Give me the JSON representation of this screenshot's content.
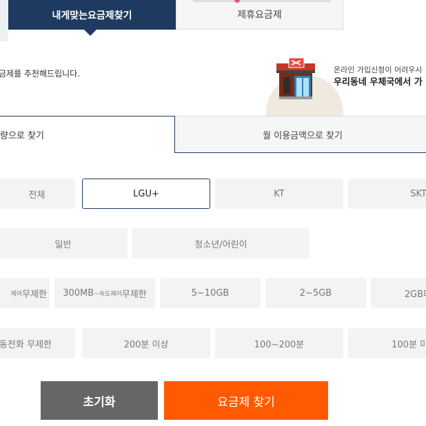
{
  "tabs": {
    "my_plan": "내게맞는요금제찾기",
    "partner_plan": "제휴요금제"
  },
  "intro_text": "금제를 추천해드립니다.",
  "notice": {
    "line1": "온라인 가입신청이 어려우시",
    "line2": "우리동네 우체국에서 가"
  },
  "subtabs": {
    "by_data": "량으로 찾기",
    "by_monthly_fee": "월 이용금액으로 찾기"
  },
  "carriers": [
    "전체",
    "LGU+",
    "KT",
    "SKT"
  ],
  "selected_carrier": "LGU+",
  "user_types": [
    "일반",
    "청소년/어린이"
  ],
  "data_options": [
    {
      "small": "제어",
      "text": "무제한"
    },
    {
      "prefix": "300MB",
      "small": "~속도제어",
      "text": "무제한"
    },
    {
      "text": "5~10GB"
    },
    {
      "text": "2~5GB"
    },
    {
      "text": "2GB미"
    }
  ],
  "voice_options": [
    "동전화 무제한",
    "200분 이상",
    "100~200분",
    "100분 미"
  ],
  "buttons": {
    "reset": "초기화",
    "search": "요금제 찾기"
  },
  "colors": {
    "navy": "#1f3a60",
    "orange": "#ff5a00",
    "gray_button": "#666666",
    "chip_bg": "#f3f3f3"
  }
}
